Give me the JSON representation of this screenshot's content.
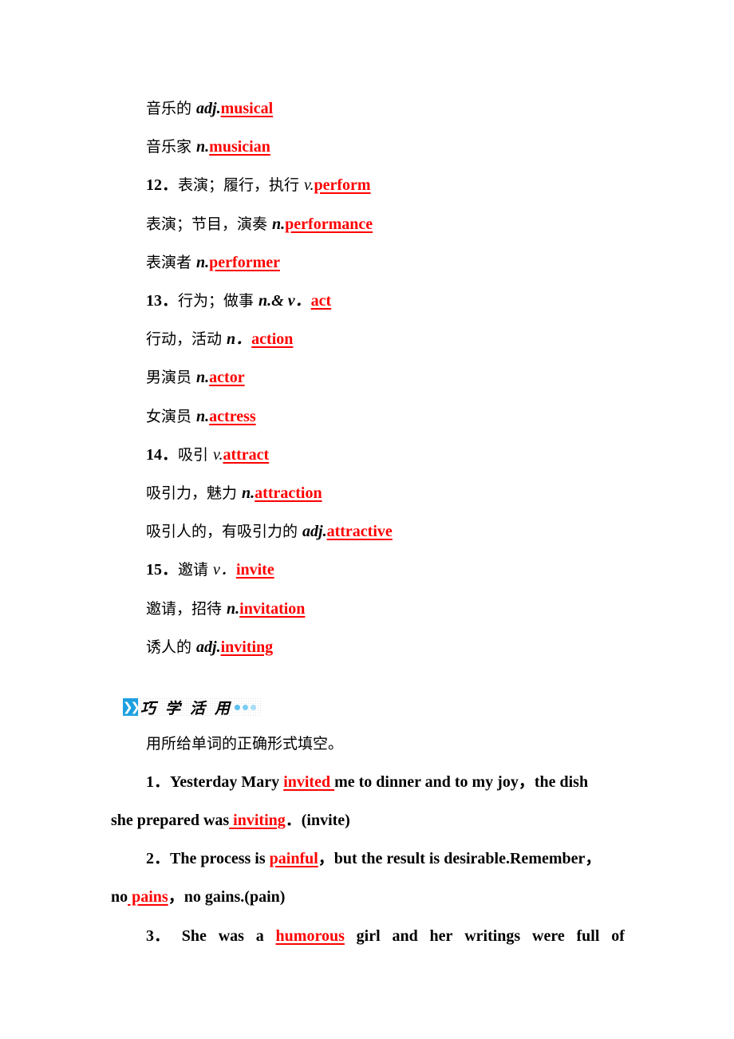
{
  "vocabulary": [
    {
      "num": "",
      "cn": "音乐的 ",
      "pos": "adj.",
      "answer": "musical"
    },
    {
      "num": "",
      "cn": "音乐家 ",
      "pos": "n.",
      "answer": "musician"
    },
    {
      "num": "12．",
      "cn": "表演；履行，执行 ",
      "pos": "v.",
      "answer": "perform"
    },
    {
      "num": "",
      "cn": "表演；节目，演奏 ",
      "pos": "n.",
      "answer": "performance"
    },
    {
      "num": "",
      "cn": "表演者 ",
      "pos": "n.",
      "answer": "performer"
    },
    {
      "num": "13．",
      "cn": "行为；做事 ",
      "pos": "n.& v．",
      "answer": "act"
    },
    {
      "num": "",
      "cn": "行动，活动 ",
      "pos": "n．",
      "answer": "action"
    },
    {
      "num": "",
      "cn": "男演员 ",
      "pos": "n.",
      "answer": "actor"
    },
    {
      "num": "",
      "cn": "女演员 ",
      "pos": "n.",
      "answer": "actress"
    },
    {
      "num": "14．",
      "cn": "吸引 ",
      "pos": "v.",
      "answer": "attract"
    },
    {
      "num": "",
      "cn": "吸引力，魅力 ",
      "pos": "n.",
      "answer": "attraction"
    },
    {
      "num": "",
      "cn": "吸引人的，有吸引力的 ",
      "pos": "adj.",
      "answer": "attractive"
    },
    {
      "num": "15．",
      "cn": "邀请 ",
      "pos": "v．",
      "answer": "invite"
    },
    {
      "num": "",
      "cn": "邀请，招待 ",
      "pos": "n.",
      "answer": "invitation"
    },
    {
      "num": "",
      "cn": "诱人的 ",
      "pos": "adj.",
      "answer": "inviting"
    }
  ],
  "section": {
    "title": "巧学活用",
    "icon": "double-chevron-icon",
    "accent_color": "#1ea0e0",
    "dot_colors": [
      "#5cc0f0",
      "#7ccdf4",
      "#a9ddf7"
    ]
  },
  "instruction": "用所给单词的正确形式填空。",
  "exercises": {
    "q1": {
      "line1_prefix": "1．Yesterday Mary ",
      "ans1": "invited ",
      "line1_suffix": "me to dinner and to my joy，the dish",
      "line2_prefix": "she prepared was",
      "ans2": " inviting",
      "line2_suffix": "．(invite)"
    },
    "q2": {
      "line1_prefix": "2．The process is ",
      "ans1": "painful",
      "line1_suffix": "，but the result is desirable.Remember，",
      "line2_prefix": "no",
      "ans2": " pains",
      "line2_suffix": "，no gains.(pain)"
    },
    "q3": {
      "words_before": [
        "3．",
        "She",
        "was",
        "a"
      ],
      "ans1": "humorous",
      "words_after": [
        "girl",
        "and",
        "her",
        "writings",
        "were",
        "full",
        "of"
      ]
    }
  },
  "colors": {
    "answer": "#ff0000",
    "text": "#000000"
  }
}
